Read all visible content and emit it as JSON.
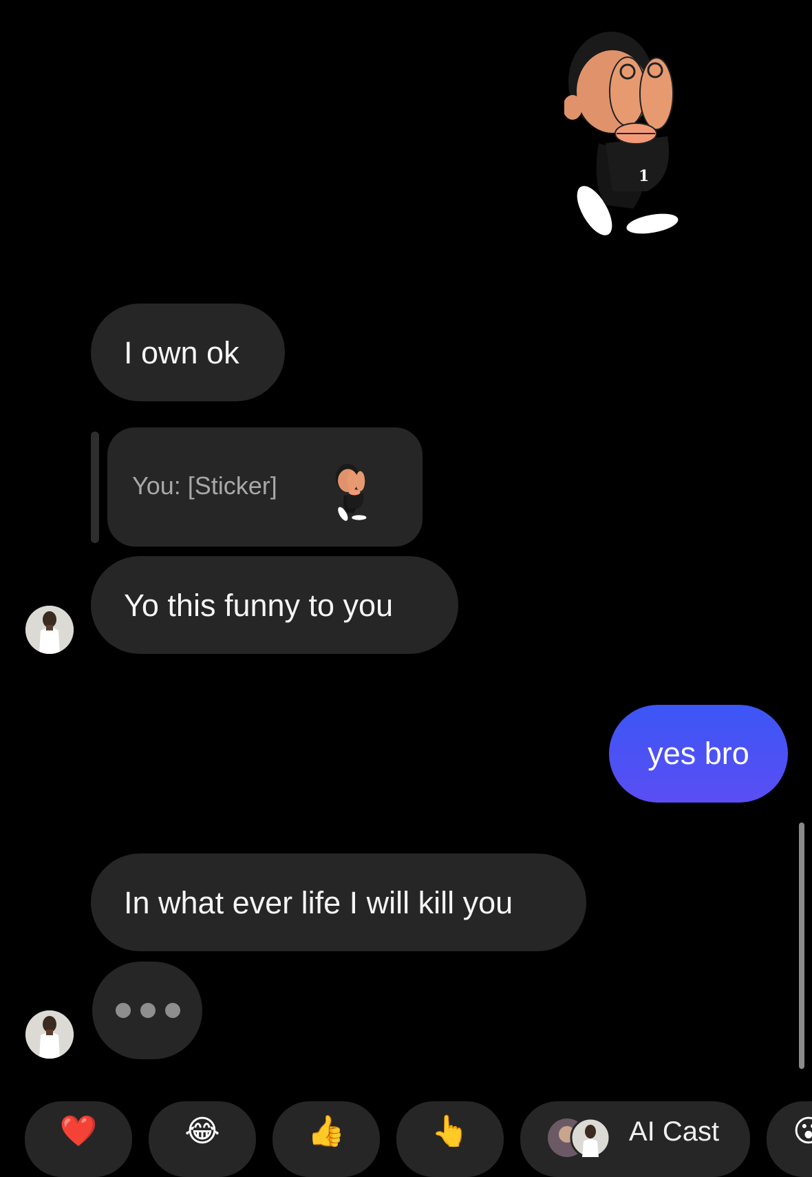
{
  "messages": {
    "incoming_1": "I own ok",
    "reply_preview": "You: [Sticker]",
    "incoming_2": "Yo this funny to you",
    "outgoing_1": "yes bro",
    "incoming_3": "In what ever life I will kill you"
  },
  "quick_reactions": [
    {
      "emoji": "❤️",
      "icon": "heart-icon"
    },
    {
      "emoji": "😂",
      "icon": "laughing-tears-icon"
    },
    {
      "emoji": "👍",
      "icon": "thumbs-up-icon"
    },
    {
      "emoji": "👆",
      "icon": "pointing-up-icon"
    },
    {
      "label": "AI Cast",
      "icon": "ai-cast-avatars"
    },
    {
      "emoji": "😮",
      "icon": "face-icon"
    }
  ],
  "colors": {
    "background": "#000000",
    "incoming_bubble": "#262626",
    "outgoing_bubble": "#4a52f5",
    "reply_text": "#a8a8a8"
  }
}
